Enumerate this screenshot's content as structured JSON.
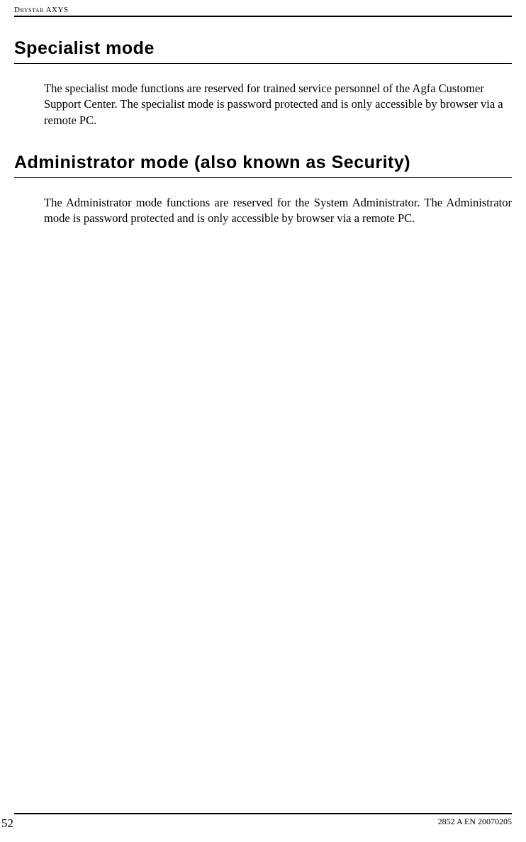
{
  "header": {
    "product": "Drystar AXYS"
  },
  "sections": [
    {
      "heading": "Specialist mode",
      "body": "The specialist mode functions are reserved for trained service personnel of the Agfa Customer Support Center. The specialist mode is password protected and is only accessible by browser via a remote PC."
    },
    {
      "heading": "Administrator mode (also known as Security)",
      "body": "The Administrator mode functions are reserved for the System Administrator. The Administrator mode is password protected and is only accessible by browser via a remote PC."
    }
  ],
  "footer": {
    "page_number": "52",
    "doc_code": "2852 A EN 20070205"
  }
}
